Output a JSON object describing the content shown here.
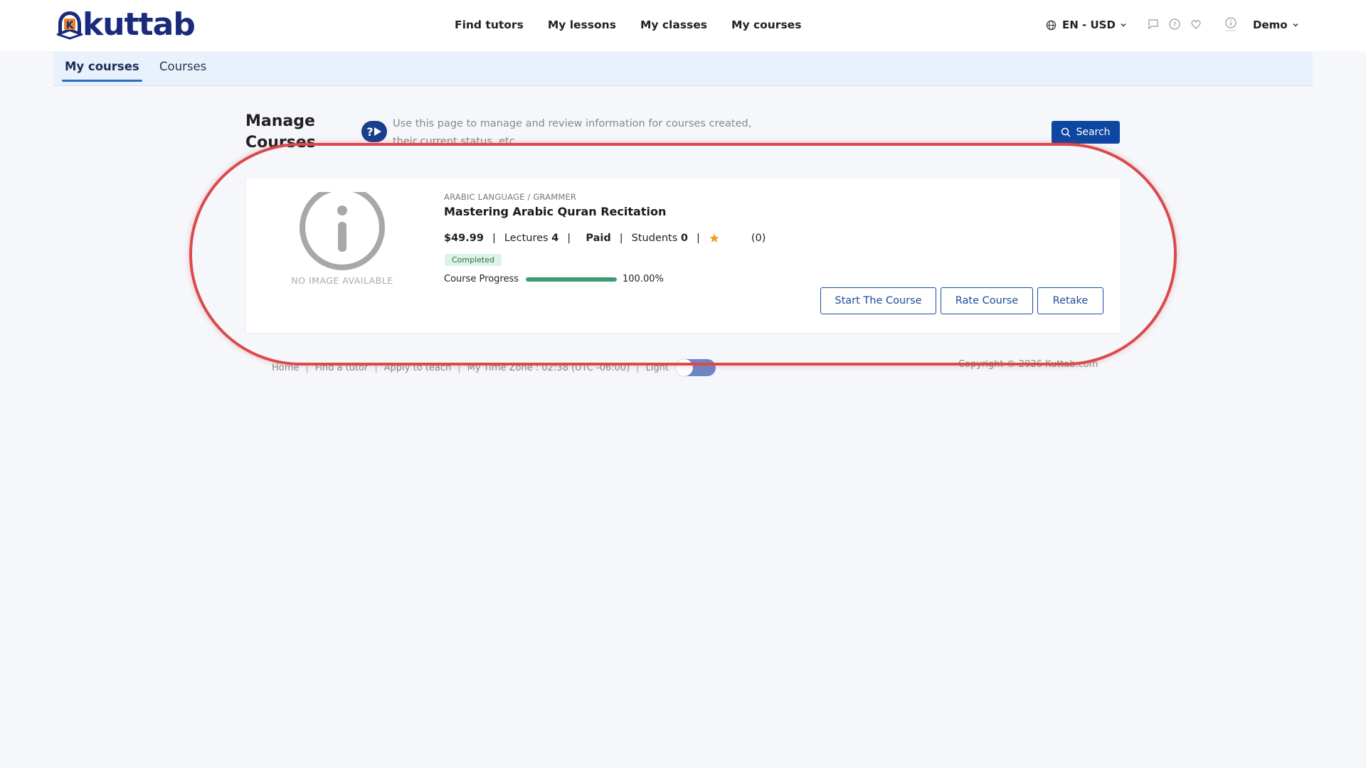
{
  "header": {
    "logo_text": "kuttab",
    "logo_badge_letter": "K",
    "nav": [
      "Find tutors",
      "My lessons",
      "My classes",
      "My courses"
    ],
    "language_currency": "EN - USD",
    "user_name": "Demo",
    "icons": [
      "chat-icon",
      "help-icon",
      "heart-icon",
      "info-icon",
      "globe-icon",
      "chevron-down-icon"
    ],
    "brand_color": "#1a2a7c"
  },
  "tabs": {
    "active": "My courses",
    "other": "Courses"
  },
  "manage": {
    "title": "Manage Courses",
    "help_text": "Use this page to manage and review information for courses created, their current status, etc.",
    "help_button_glyph": "?",
    "search_label": "Search"
  },
  "course": {
    "image_text": "NO IMAGE AVAILABLE",
    "category": "ARABIC LANGUAGE / GRAMMER",
    "title": "Mastering Arabic Quran Recitation",
    "price": "$49.99",
    "lectures_label": "Lectures",
    "lectures_count": "4",
    "payment_status": "Paid",
    "students_label": "Students",
    "students_count": "0",
    "rating_count": "(0)",
    "status_badge": "Completed",
    "progress_label": "Course Progress",
    "progress_text": "100.00%",
    "progress_value": 1.0,
    "buttons": [
      "Start The Course",
      "Rate Course",
      "Retake"
    ],
    "accent_color": "#1a4b9c",
    "progress_color": "#3a9a72",
    "star_color": "#f0a020"
  },
  "footer": {
    "links": [
      "Home",
      "Find a tutor",
      "Apply to teach"
    ],
    "timezone": "My Time Zone : 02:38 (UTC -06:00)",
    "theme_label": "Light",
    "copyright": "Copyright © 2026 Kuttab.com"
  },
  "annotation": {
    "highlight_color": "#d94a4d"
  }
}
